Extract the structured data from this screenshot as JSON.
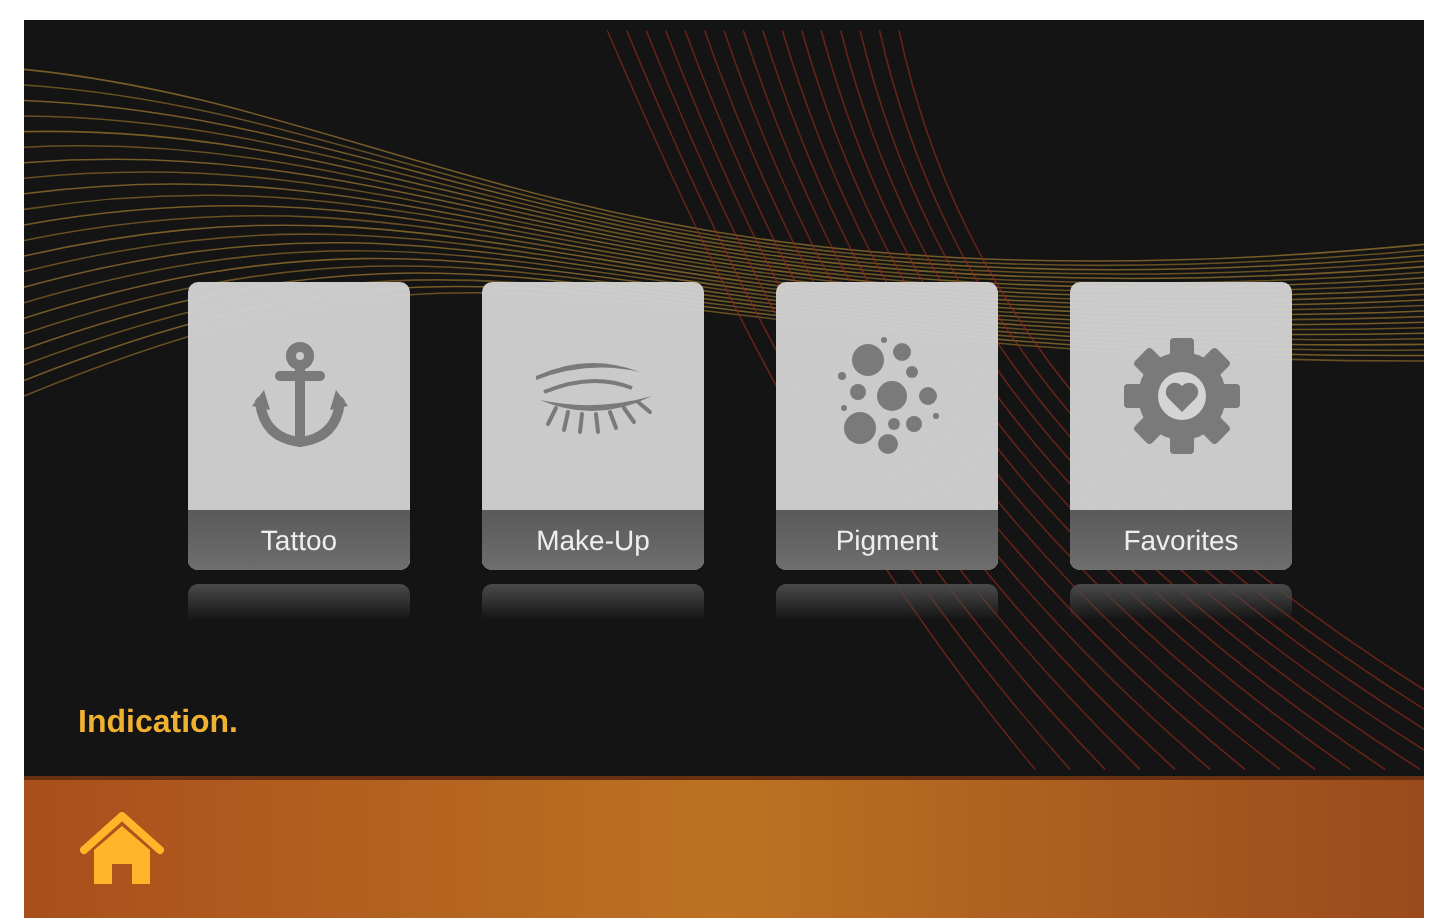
{
  "tiles": [
    {
      "label": "Tattoo",
      "kind": "anchor"
    },
    {
      "label": "Make-Up",
      "kind": "eye"
    },
    {
      "label": "Pigment",
      "kind": "dots"
    },
    {
      "label": "Favorites",
      "kind": "gear"
    }
  ],
  "indication": "Indication."
}
